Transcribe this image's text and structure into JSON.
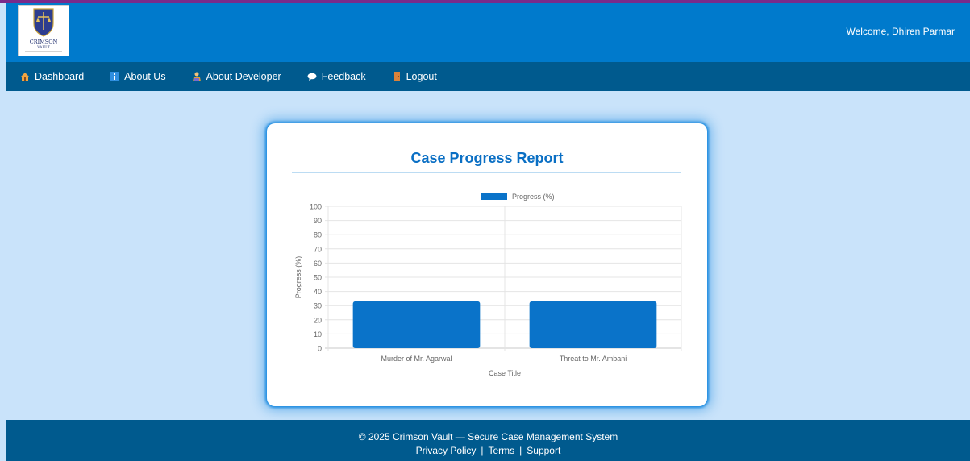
{
  "header": {
    "logo_text": "CRIMSON",
    "logo_subtext": "VAULT",
    "welcome_text": "Welcome, Dhiren Parmar"
  },
  "nav": {
    "items": [
      {
        "label": "Dashboard",
        "icon": "house-icon"
      },
      {
        "label": "About Us",
        "icon": "info-icon"
      },
      {
        "label": "About Developer",
        "icon": "developer-icon"
      },
      {
        "label": "Feedback",
        "icon": "speech-bubble-icon"
      },
      {
        "label": "Logout",
        "icon": "door-icon"
      }
    ]
  },
  "report": {
    "title": "Case Progress Report"
  },
  "chart_data": {
    "type": "bar",
    "categories": [
      "Murder of Mr. Agarwal",
      "Threat to Mr. Ambani"
    ],
    "series": [
      {
        "name": "Progress (%)",
        "values": [
          33,
          33
        ]
      }
    ],
    "xlabel": "Case Title",
    "ylabel": "Progress (%)",
    "ylim": [
      0,
      100
    ],
    "yticks": [
      0,
      10,
      20,
      30,
      40,
      50,
      60,
      70,
      80,
      90,
      100
    ],
    "grid": true,
    "legend": "top",
    "color": "#0a73c9"
  },
  "footer": {
    "copyright": "© 2025 Crimson Vault — Secure Case Management System",
    "links": [
      "Privacy Policy",
      "Terms",
      "Support"
    ],
    "separator": "|"
  }
}
